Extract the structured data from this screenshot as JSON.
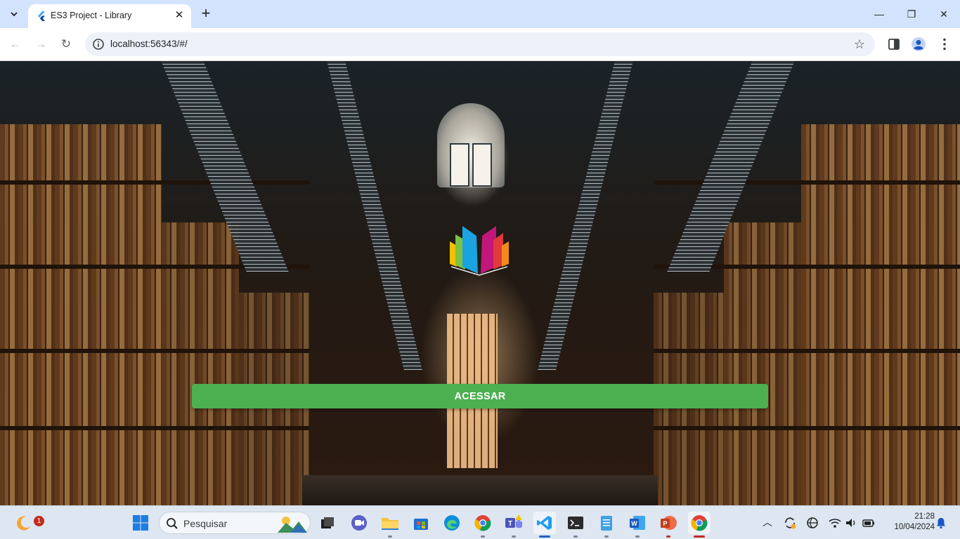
{
  "browser": {
    "tab": {
      "title": "ES3 Project - Library",
      "close": "✕"
    },
    "new_tab": "+",
    "window_controls": {
      "minimize": "—",
      "restore": "❐",
      "close": "✕"
    },
    "address": {
      "url": "localhost:56343/#/"
    },
    "icons": [
      "tab-search-icon",
      "flutter-favicon",
      "back-icon",
      "forward-icon",
      "reload-icon",
      "site-info-icon",
      "bookmark-star-icon",
      "side-panel-icon",
      "profile-icon",
      "menu-icon"
    ]
  },
  "page": {
    "background": "library-hall-photo",
    "logo": "rainbow-open-book-logo",
    "access_button": {
      "label": "ACESSAR",
      "color": "#4caf50"
    }
  },
  "taskbar": {
    "search": {
      "placeholder": "Pesquisar"
    },
    "widgets_badge": "1",
    "apps": [
      "widgets-weather",
      "start",
      "search",
      "task-view",
      "teams-meet",
      "file-explorer",
      "microsoft-store",
      "edge",
      "chrome",
      "teams",
      "vscode",
      "terminal",
      "notepad",
      "word",
      "powerpoint",
      "chrome-active"
    ],
    "tray_icons": [
      "chevron-up-icon",
      "sync-icon",
      "network-icon",
      "wifi-icon",
      "volume-icon",
      "battery-icon",
      "notifications-icon"
    ],
    "clock": {
      "time": "21:28",
      "date": "10/04/2024"
    }
  }
}
